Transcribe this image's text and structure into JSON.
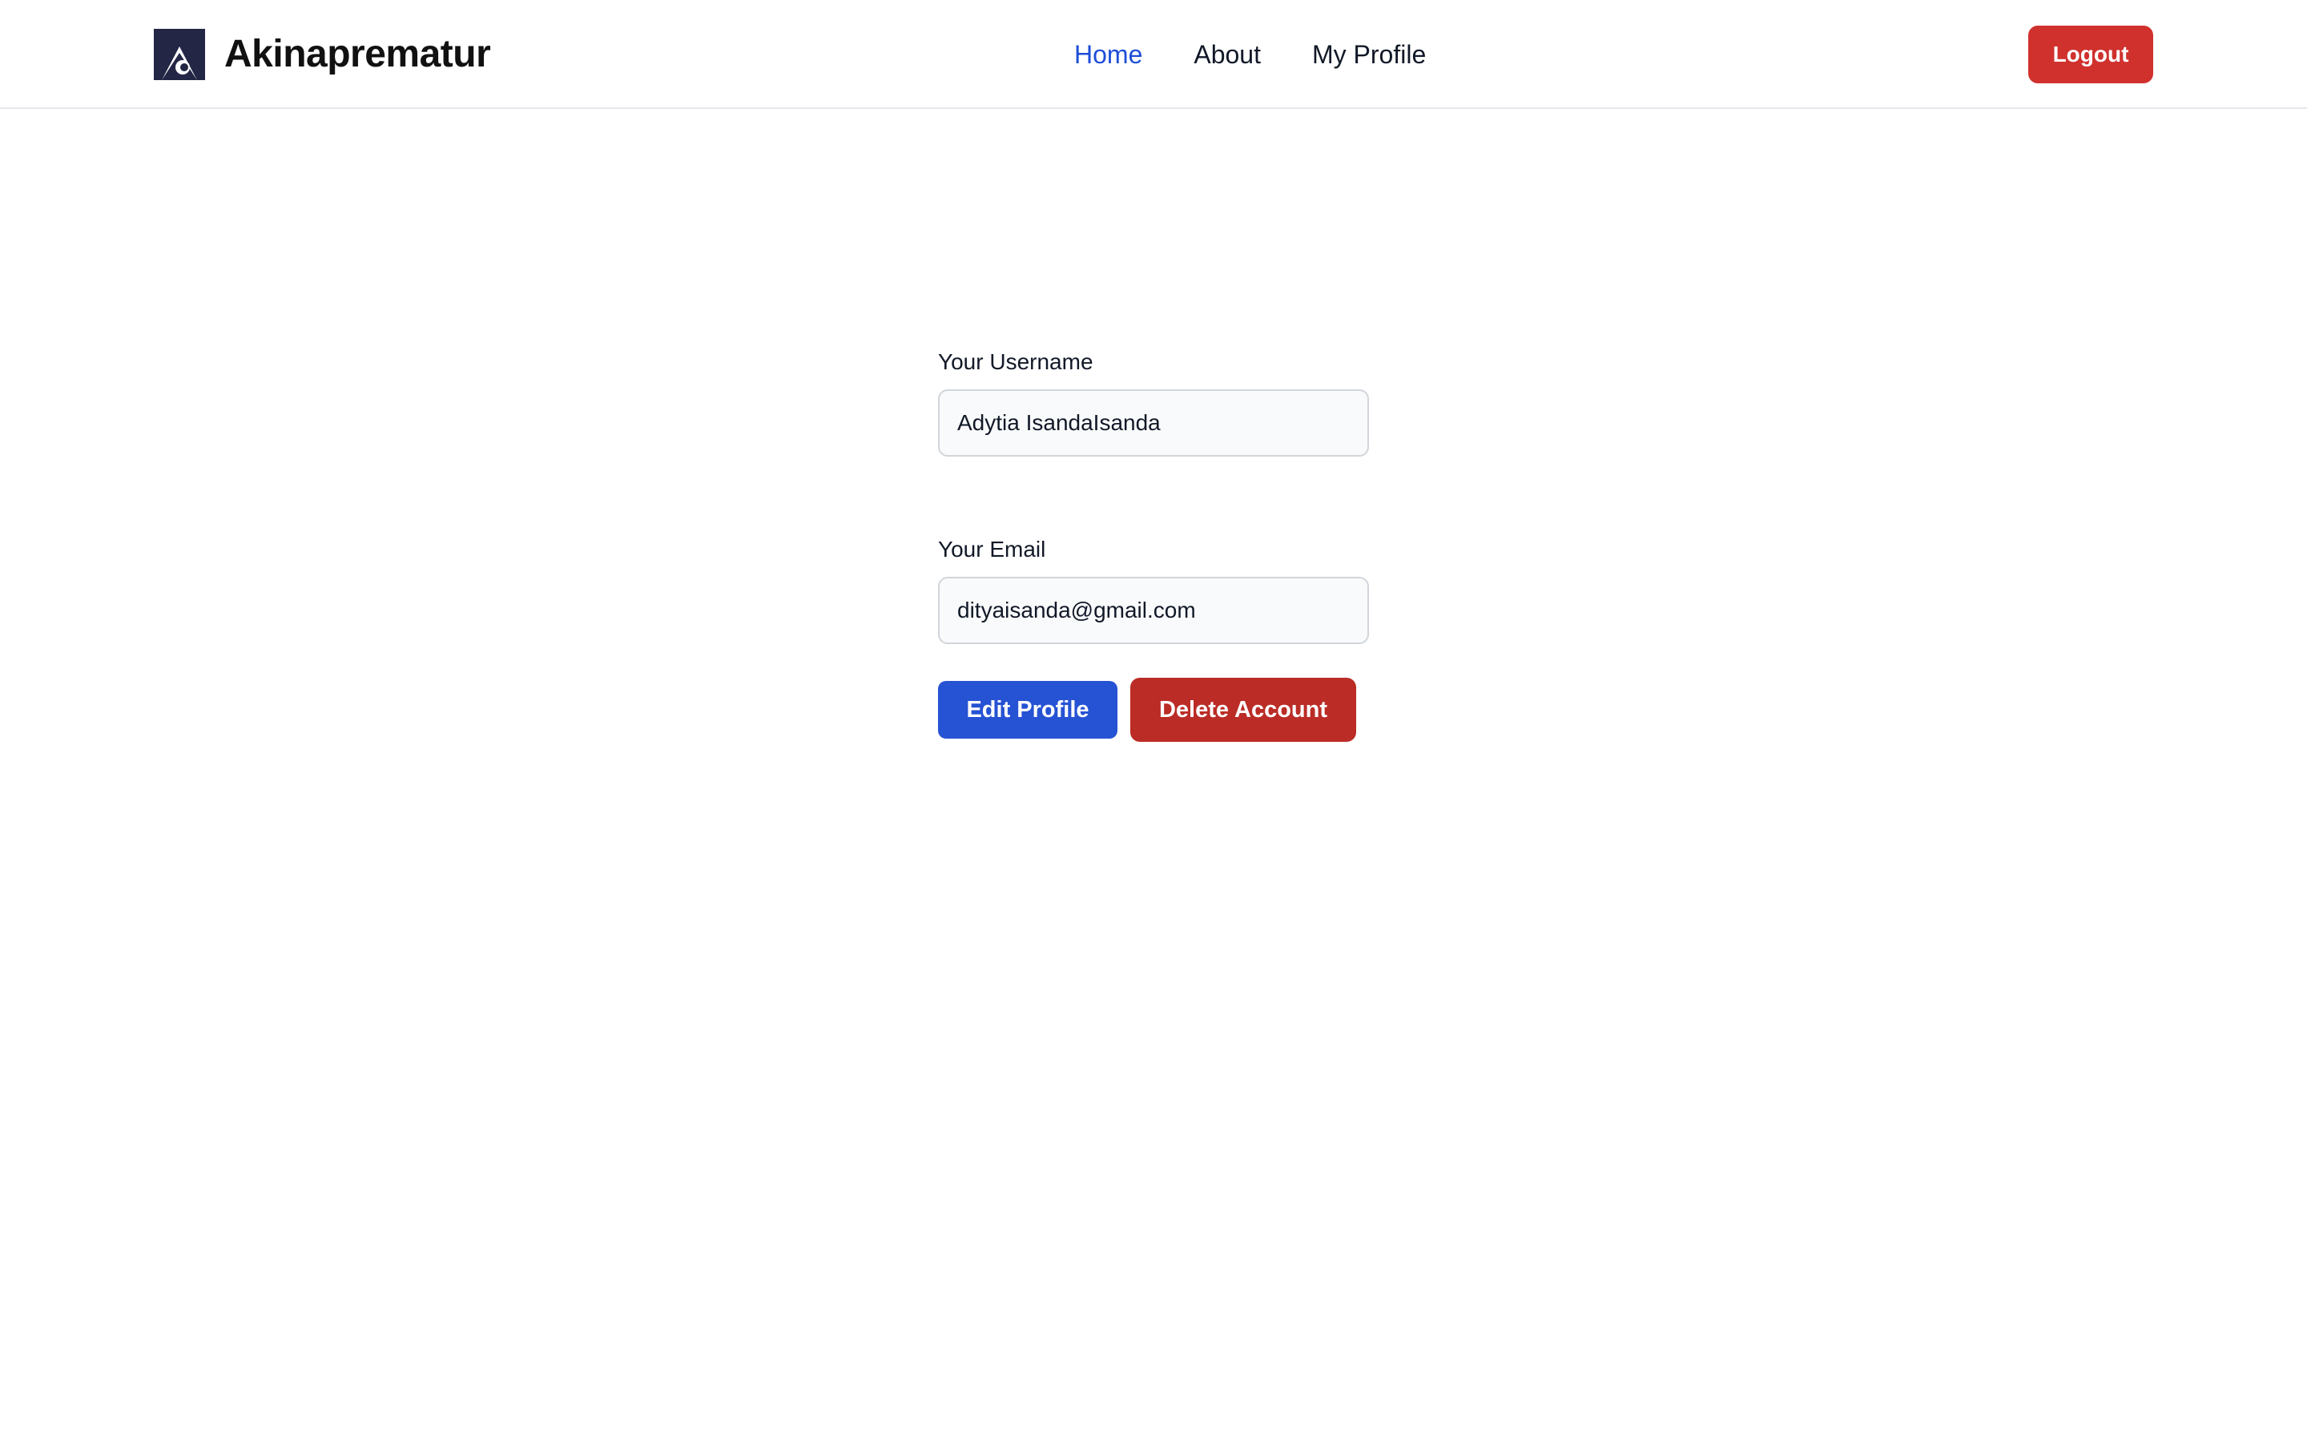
{
  "header": {
    "brand_name": "Akinaprematur",
    "logo_icon": "brand-logo-icon",
    "nav": [
      {
        "label": "Home",
        "active": true
      },
      {
        "label": "About",
        "active": false
      },
      {
        "label": "My Profile",
        "active": false
      }
    ],
    "logout_label": "Logout"
  },
  "profile": {
    "username_label": "Your Username",
    "username_value": "Adytia IsandaIsanda",
    "email_label": "Your Email",
    "email_value": "dityaisanda@gmail.com",
    "edit_label": "Edit Profile",
    "delete_label": "Delete Account"
  },
  "colors": {
    "nav_active": "#1d4ed8",
    "logout_bg": "#d0312d",
    "edit_bg": "#2652d4",
    "delete_bg": "#bb2c26",
    "logo_fill": "#232645"
  }
}
